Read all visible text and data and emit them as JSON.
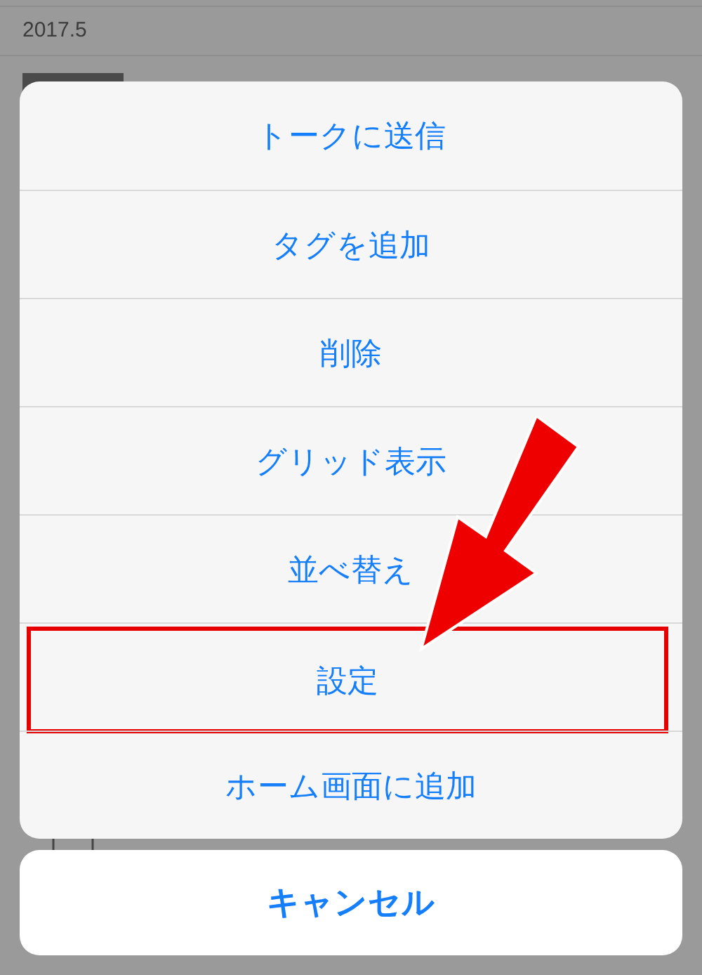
{
  "background": {
    "section_date": "2017.5"
  },
  "action_sheet": {
    "items": [
      {
        "label": "トークに送信",
        "highlighted": false
      },
      {
        "label": "タグを追加",
        "highlighted": false
      },
      {
        "label": "削除",
        "highlighted": false
      },
      {
        "label": "グリッド表示",
        "highlighted": false
      },
      {
        "label": "並べ替え",
        "highlighted": false
      },
      {
        "label": "設定",
        "highlighted": true
      },
      {
        "label": "ホーム画面に追加",
        "highlighted": false
      }
    ],
    "cancel": "キャンセル"
  }
}
